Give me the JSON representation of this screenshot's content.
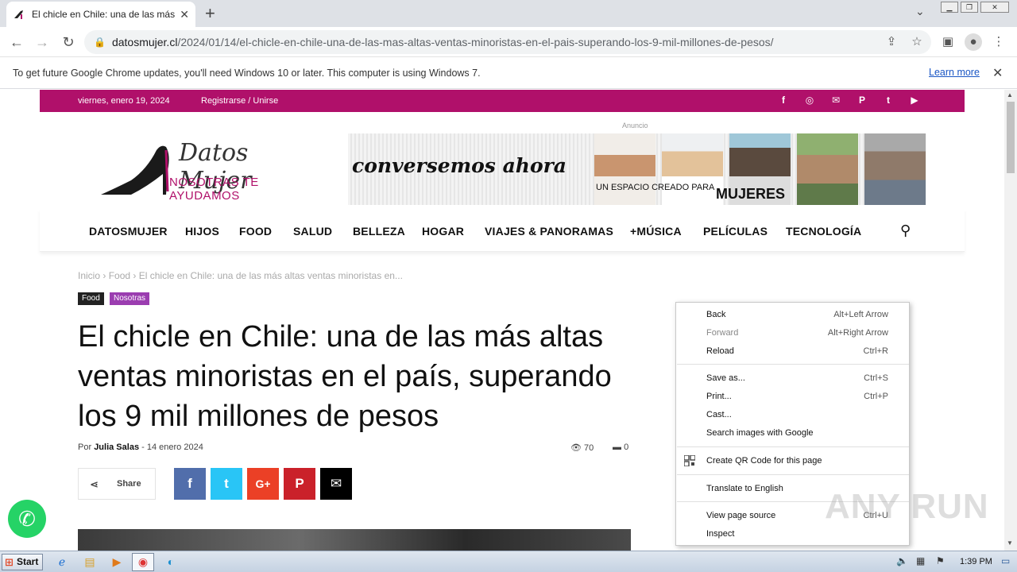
{
  "browser": {
    "tab_title": "El chicle en Chile: una de las más alta",
    "new_tab": "+",
    "url_host": "datosmujer.cl",
    "url_path": "/2024/01/14/el-chicle-en-chile-una-de-las-mas-altas-ventas-minoristas-en-el-pais-superando-los-9-mil-millones-de-pesos/",
    "infobar_text": "To get future Google Chrome updates, you'll need Windows 10 or later. This computer is using Windows 7.",
    "infobar_link": "Learn more"
  },
  "site": {
    "date": "viernes, enero 19, 2024",
    "register": "Registrarse / Unirse",
    "social": [
      "f",
      "◎",
      "✉",
      "P",
      "t",
      "▶"
    ],
    "ad_label": "Anuncio",
    "logo_title": "Datos Mujer",
    "logo_tagline": "NOSOTRAS TE AYUDAMOS",
    "ad_slogan": "conversemos ahora",
    "ad_sub": "UN ESPACIO CREADO PARA",
    "ad_mujeres": "MUJERES",
    "ad_faces": [
      "#c9956f",
      "#e3c29a",
      "#5a4a3e",
      "#b08a6a",
      "#8f7a6a"
    ],
    "nav": [
      "DATOSMUJER",
      "HIJOS",
      "FOOD",
      "SALUD",
      "BELLEZA",
      "HOGAR",
      "VIAJES & PANORAMAS",
      "+MÚSICA",
      "PELÍCULAS",
      "TECNOLOGÍA"
    ]
  },
  "article": {
    "breadcrumb_home": "Inicio",
    "breadcrumb_cat": "Food",
    "breadcrumb_current": "El chicle en Chile: una de las más altas ventas minoristas en...",
    "tags": [
      "Food",
      "Nosotras"
    ],
    "title": "El chicle en Chile: una de las más altas ventas minoristas en el país, superando los 9 mil millones de pesos",
    "by": "Por",
    "author": "Julia Salas",
    "dash": "-",
    "date": "14 enero 2024",
    "views": "70",
    "comments": "0",
    "share_label": "Share",
    "share_buttons": [
      {
        "icon": "f",
        "color": "#516eab"
      },
      {
        "icon": "t",
        "color": "#29c5f6"
      },
      {
        "icon": "G+",
        "color": "#eb4026"
      },
      {
        "icon": "P",
        "color": "#ca212a"
      },
      {
        "icon": "✉",
        "color": "#000000"
      }
    ]
  },
  "context_menu": {
    "items": [
      {
        "label": "Back",
        "shortcut": "Alt+Left Arrow",
        "disabled": false
      },
      {
        "label": "Forward",
        "shortcut": "Alt+Right Arrow",
        "disabled": true
      },
      {
        "label": "Reload",
        "shortcut": "Ctrl+R",
        "disabled": false
      },
      {
        "label": "Save as...",
        "shortcut": "Ctrl+S",
        "disabled": false
      },
      {
        "label": "Print...",
        "shortcut": "Ctrl+P",
        "disabled": false
      },
      {
        "label": "Cast...",
        "shortcut": "",
        "disabled": false
      },
      {
        "label": "Search images with Google",
        "shortcut": "",
        "disabled": false
      },
      {
        "label": "Create QR Code for this page",
        "shortcut": "",
        "disabled": false
      },
      {
        "label": "Translate to English",
        "shortcut": "",
        "disabled": false
      },
      {
        "label": "View page source",
        "shortcut": "Ctrl+U",
        "disabled": false
      },
      {
        "label": "Inspect",
        "shortcut": "",
        "disabled": false
      }
    ]
  },
  "watermark": "ANY RUN",
  "taskbar": {
    "start": "Start",
    "time": "1:39 PM"
  }
}
